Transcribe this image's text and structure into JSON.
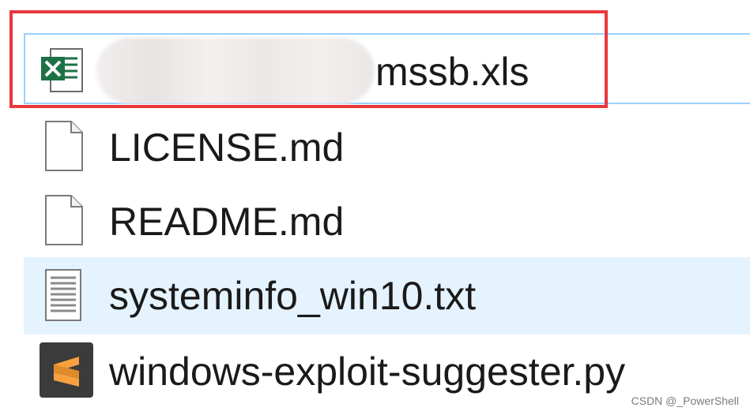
{
  "files": [
    {
      "name": "mssb.xls",
      "icon": "excel-file-icon"
    },
    {
      "name": "LICENSE.md",
      "icon": "blank-file-icon"
    },
    {
      "name": "README.md",
      "icon": "blank-file-icon"
    },
    {
      "name": "systeminfo_win10.txt",
      "icon": "text-file-icon"
    },
    {
      "name": "windows-exploit-suggester.py",
      "icon": "sublime-text-icon"
    }
  ],
  "watermark": "CSDN @_PowerShell",
  "colors": {
    "highlight_border": "#e8383d",
    "selection_frame": "#99d1ff",
    "hover_background": "#e5f3ff",
    "excel_green": "#1e7145",
    "sublime_orange": "#f9a03f"
  }
}
